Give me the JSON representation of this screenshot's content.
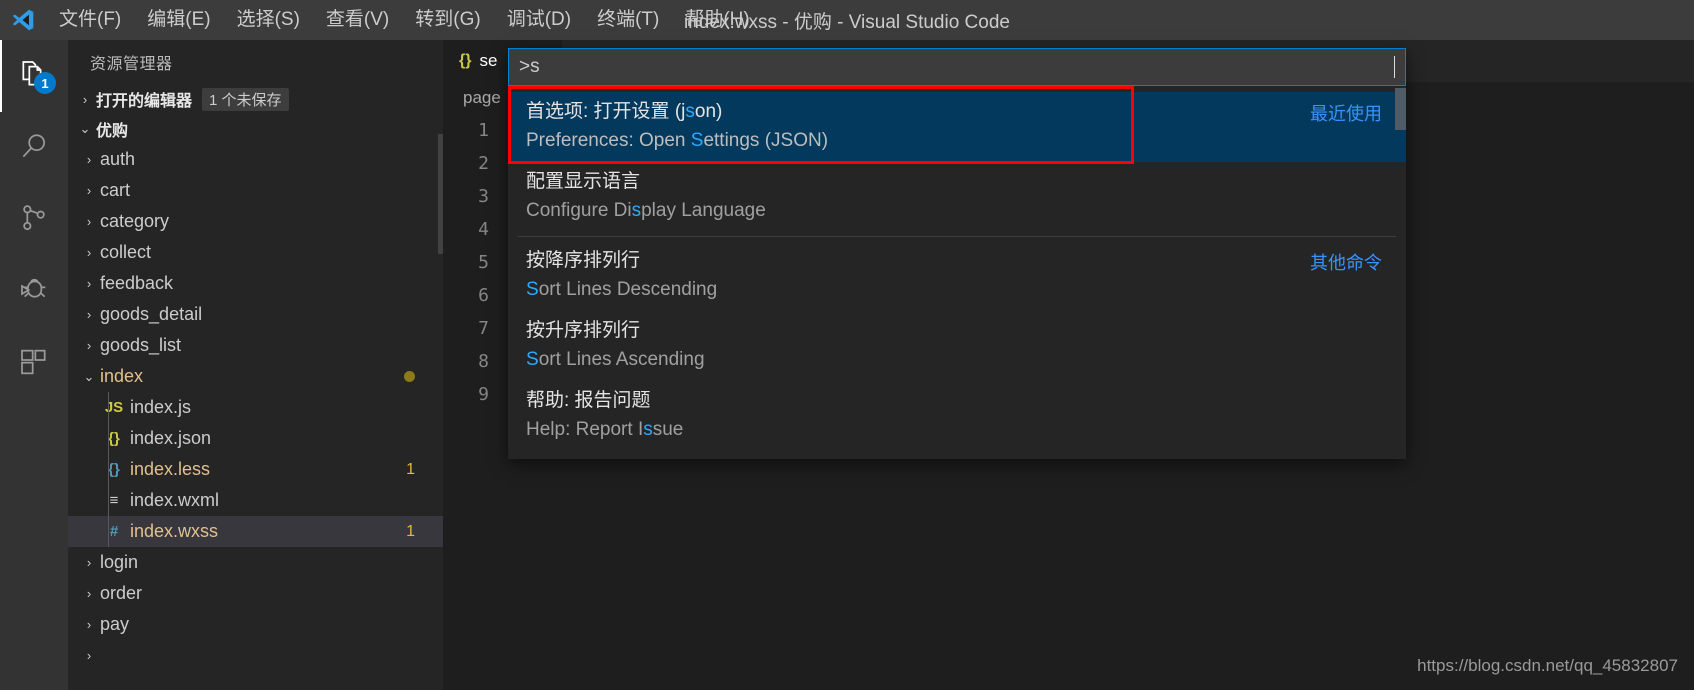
{
  "titlebar": {
    "logo_icon": "vscode-logo-icon",
    "window_title": "index.wxss - 优购 - Visual Studio Code",
    "menus": [
      {
        "label": "文件(F)",
        "name": "menu-file"
      },
      {
        "label": "编辑(E)",
        "name": "menu-edit"
      },
      {
        "label": "选择(S)",
        "name": "menu-selection"
      },
      {
        "label": "查看(V)",
        "name": "menu-view"
      },
      {
        "label": "转到(G)",
        "name": "menu-go"
      },
      {
        "label": "调试(D)",
        "name": "menu-debug"
      },
      {
        "label": "终端(T)",
        "name": "menu-terminal"
      },
      {
        "label": "帮助(H)",
        "name": "menu-help"
      }
    ]
  },
  "activitybar": {
    "items": [
      {
        "icon": "files-explorer-icon",
        "badge": "1",
        "active": true
      },
      {
        "icon": "search-icon",
        "badge": "",
        "active": false
      },
      {
        "icon": "source-control-icon",
        "badge": "",
        "active": false
      },
      {
        "icon": "debug-run-icon",
        "badge": "",
        "active": false
      },
      {
        "icon": "extensions-icon",
        "badge": "",
        "active": false
      }
    ]
  },
  "sidebar": {
    "title": "资源管理器",
    "open_editors": {
      "label": "打开的编辑器",
      "badge": "1 个未保存",
      "twisty": "›"
    },
    "project": {
      "label": "优购",
      "twisty": "⌄"
    },
    "tree": [
      {
        "name": "auth",
        "type": "folder",
        "indent": 1,
        "chev": "›",
        "color": "plain",
        "badge": "",
        "dot": false,
        "selected": false,
        "icon": ""
      },
      {
        "name": "cart",
        "type": "folder",
        "indent": 1,
        "chev": "›",
        "color": "plain",
        "badge": "",
        "dot": false,
        "selected": false,
        "icon": ""
      },
      {
        "name": "category",
        "type": "folder",
        "indent": 1,
        "chev": "›",
        "color": "plain",
        "badge": "",
        "dot": false,
        "selected": false,
        "icon": ""
      },
      {
        "name": "collect",
        "type": "folder",
        "indent": 1,
        "chev": "›",
        "color": "plain",
        "badge": "",
        "dot": false,
        "selected": false,
        "icon": ""
      },
      {
        "name": "feedback",
        "type": "folder",
        "indent": 1,
        "chev": "›",
        "color": "plain",
        "badge": "",
        "dot": false,
        "selected": false,
        "icon": ""
      },
      {
        "name": "goods_detail",
        "type": "folder",
        "indent": 1,
        "chev": "›",
        "color": "plain",
        "badge": "",
        "dot": false,
        "selected": false,
        "icon": ""
      },
      {
        "name": "goods_list",
        "type": "folder",
        "indent": 1,
        "chev": "›",
        "color": "plain",
        "badge": "",
        "dot": false,
        "selected": false,
        "icon": ""
      },
      {
        "name": "index",
        "type": "folder",
        "indent": 1,
        "chev": "⌄",
        "color": "mod",
        "badge": "",
        "dot": true,
        "selected": false,
        "icon": ""
      },
      {
        "name": "index.js",
        "type": "file",
        "indent": 2,
        "chev": "",
        "color": "plain",
        "badge": "",
        "dot": false,
        "selected": false,
        "icon": "js-file-icon",
        "glyph": "JS"
      },
      {
        "name": "index.json",
        "type": "file",
        "indent": 2,
        "chev": "",
        "color": "plain",
        "badge": "",
        "dot": false,
        "selected": false,
        "icon": "json-file-icon",
        "glyph": "{}"
      },
      {
        "name": "index.less",
        "type": "file",
        "indent": 2,
        "chev": "",
        "color": "mod",
        "badge": "1",
        "dot": false,
        "selected": false,
        "icon": "less-file-icon",
        "glyph": "{}"
      },
      {
        "name": "index.wxml",
        "type": "file",
        "indent": 2,
        "chev": "",
        "color": "plain",
        "badge": "",
        "dot": false,
        "selected": false,
        "icon": "xml-file-icon",
        "glyph": "≡"
      },
      {
        "name": "index.wxss",
        "type": "file",
        "indent": 2,
        "chev": "",
        "color": "mod",
        "badge": "1",
        "dot": false,
        "selected": true,
        "icon": "wxss-file-icon",
        "glyph": "#"
      },
      {
        "name": "login",
        "type": "folder",
        "indent": 1,
        "chev": "›",
        "color": "plain",
        "badge": "",
        "dot": false,
        "selected": false,
        "icon": ""
      },
      {
        "name": "order",
        "type": "folder",
        "indent": 1,
        "chev": "›",
        "color": "plain",
        "badge": "",
        "dot": false,
        "selected": false,
        "icon": ""
      },
      {
        "name": "pay",
        "type": "folder",
        "indent": 1,
        "chev": "›",
        "color": "plain",
        "badge": "",
        "dot": false,
        "selected": false,
        "icon": ""
      },
      {
        "name": "",
        "type": "folder",
        "indent": 1,
        "chev": "›",
        "color": "plain",
        "badge": "",
        "dot": false,
        "selected": false,
        "icon": ""
      }
    ]
  },
  "editor": {
    "tab": {
      "label": "se",
      "icon": "json-file-icon",
      "glyph": "{}"
    },
    "breadcrumb": "page",
    "line_numbers": [
      "1",
      "2",
      "3",
      "4",
      "5",
      "6",
      "7",
      "8",
      "9"
    ]
  },
  "palette": {
    "input_value": ">s",
    "placeholder": "",
    "items": [
      {
        "label_pre": "首选项: 打开设置 (j",
        "label_hl": "s",
        "label_post": "on)",
        "sub_pre": "Preferences: Open ",
        "sub_hl": "S",
        "sub_post": "ettings (JSON)",
        "group": "最近使用",
        "focused": true,
        "separator_after": false
      },
      {
        "label_pre": "配置显示语言",
        "label_hl": "",
        "label_post": "",
        "sub_pre": "Configure Di",
        "sub_hl": "s",
        "sub_post": "play Language",
        "group": "",
        "focused": false,
        "separator_after": true
      },
      {
        "label_pre": "按降序排列行",
        "label_hl": "",
        "label_post": "",
        "sub_pre": "",
        "sub_hl": "S",
        "sub_post": "ort Lines Descending",
        "group": "其他命令",
        "focused": false,
        "separator_after": false
      },
      {
        "label_pre": "按升序排列行",
        "label_hl": "",
        "label_post": "",
        "sub_pre": "",
        "sub_hl": "S",
        "sub_post": "ort Lines Ascending",
        "group": "",
        "focused": false,
        "separator_after": false
      },
      {
        "label_pre": "帮助: 报告问题",
        "label_hl": "",
        "label_post": "",
        "sub_pre": "Help: Report I",
        "sub_hl": "s",
        "sub_post": "sue",
        "group": "",
        "focused": false,
        "separator_after": false
      }
    ]
  },
  "watermark": "https://blog.csdn.net/qq_45832807",
  "colors": {
    "accent": "#007acc",
    "focus_row": "#04395e",
    "highlight_text": "#2aaaff",
    "group_label": "#3794ff",
    "modified_file": "#e2c08d",
    "annotation_box": "#ff0000"
  }
}
